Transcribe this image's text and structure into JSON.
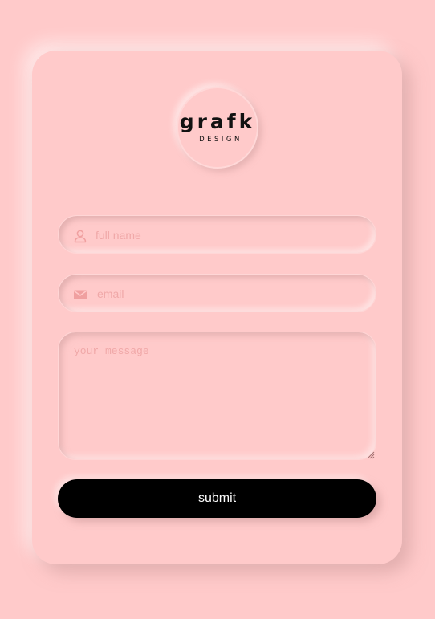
{
  "logo": {
    "word": "grafk",
    "sub": "DESIGN"
  },
  "form": {
    "name_placeholder": "full name",
    "email_placeholder": "email",
    "message_placeholder": "your message",
    "submit_label": "submit"
  },
  "icons": {
    "name": "user-icon",
    "email": "envelope-icon"
  },
  "colors": {
    "background": "#ffcaca",
    "placeholder": "#f0a8a8",
    "button": "#000000",
    "button_text": "#ffffff"
  }
}
